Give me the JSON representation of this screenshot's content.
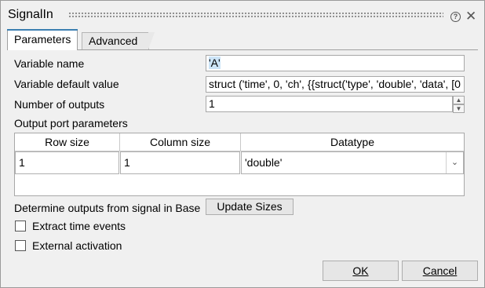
{
  "window": {
    "title": "SignalIn"
  },
  "tabs": [
    {
      "label": "Parameters",
      "active": true
    },
    {
      "label": "Advanced",
      "active": false
    }
  ],
  "icons": {
    "help": "help-icon",
    "close": "close-icon"
  },
  "fields": {
    "variable_name": {
      "label": "Variable name",
      "value": "'A'"
    },
    "variable_default": {
      "label": "Variable default value",
      "value": "struct ('time', 0, 'ch', {{struct('type', 'double', 'data', [0"
    },
    "num_outputs": {
      "label": "Number of outputs",
      "value": "1"
    }
  },
  "output_port": {
    "label": "Output port parameters",
    "columns": [
      "Row size",
      "Column size",
      "Datatype"
    ],
    "rows": [
      {
        "row_size": "1",
        "column_size": "1",
        "datatype": "'double'"
      }
    ]
  },
  "determine": {
    "label": "Determine outputs from signal in Base",
    "button": "Update Sizes"
  },
  "checkboxes": [
    {
      "label": "Extract time events",
      "checked": false
    },
    {
      "label": "External activation",
      "checked": false
    }
  ],
  "buttons": {
    "ok": "OK",
    "cancel": "Cancel"
  },
  "colors": {
    "accent": "#3c7fb1",
    "selection": "#cce4f7"
  }
}
